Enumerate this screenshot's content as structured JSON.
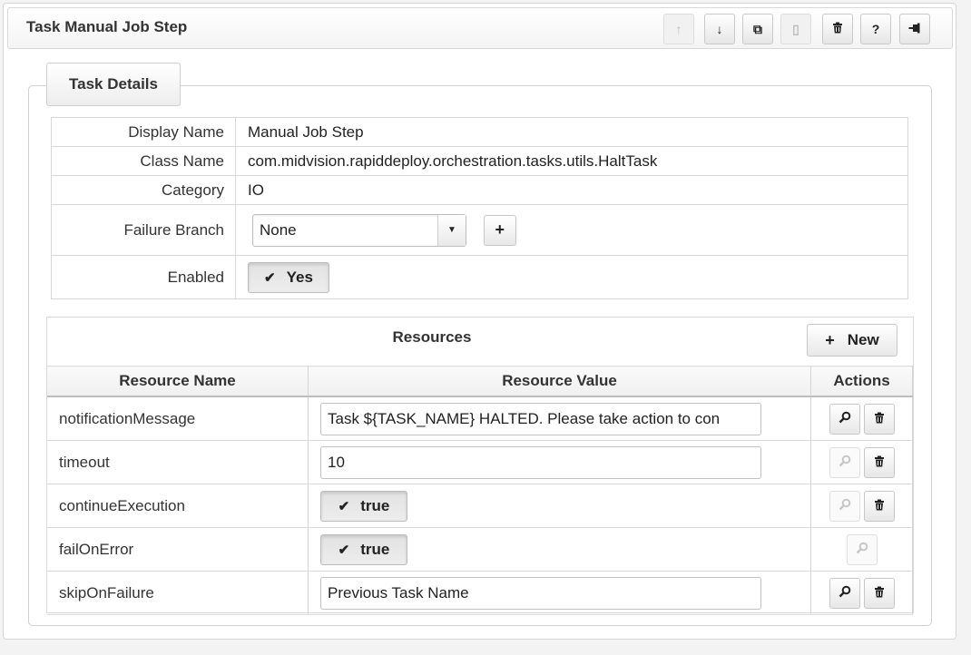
{
  "header": {
    "title": "Task Manual Job Step"
  },
  "toolbar": [
    {
      "name": "move-up-button",
      "glyph": "↑",
      "disabled": true
    },
    {
      "name": "move-down-button",
      "glyph": "↓",
      "disabled": false
    },
    {
      "name": "copy-button",
      "glyph": "⧉",
      "disabled": false
    },
    {
      "name": "paste-button",
      "glyph": "▯",
      "disabled": true
    },
    {
      "name": "delete-button",
      "glyph": "trash",
      "disabled": false
    },
    {
      "name": "help-button",
      "glyph": "?",
      "disabled": false
    },
    {
      "name": "pin-button",
      "glyph": "pin",
      "disabled": false
    }
  ],
  "details": {
    "legend": "Task Details",
    "display_name_label": "Display Name",
    "display_name": "Manual Job Step",
    "class_name_label": "Class Name",
    "class_name": "com.midvision.rapiddeploy.orchestration.tasks.utils.HaltTask",
    "category_label": "Category",
    "category": "IO",
    "failure_branch_label": "Failure Branch",
    "failure_branch": "None",
    "add_label": "+",
    "enabled_label": "Enabled",
    "enabled": "Yes"
  },
  "resources": {
    "title": "Resources",
    "new_label": "New",
    "columns": [
      "Resource Name",
      "Resource Value",
      "Actions"
    ],
    "rows": [
      {
        "name": "notificationMessage",
        "value": "Task ${TASK_NAME} HALTED.  Please take action to con",
        "kind": "text",
        "view_enabled": true,
        "has_delete": true
      },
      {
        "name": "timeout",
        "value": "10",
        "kind": "text",
        "view_enabled": false,
        "has_delete": true
      },
      {
        "name": "continueExecution",
        "value": "true",
        "kind": "toggle",
        "view_enabled": false,
        "has_delete": true
      },
      {
        "name": "failOnError",
        "value": "true",
        "kind": "toggle",
        "view_enabled": false,
        "has_delete": false
      },
      {
        "name": "skipOnFailure",
        "value": "Previous Task Name",
        "kind": "text",
        "view_enabled": true,
        "has_delete": true
      }
    ]
  }
}
